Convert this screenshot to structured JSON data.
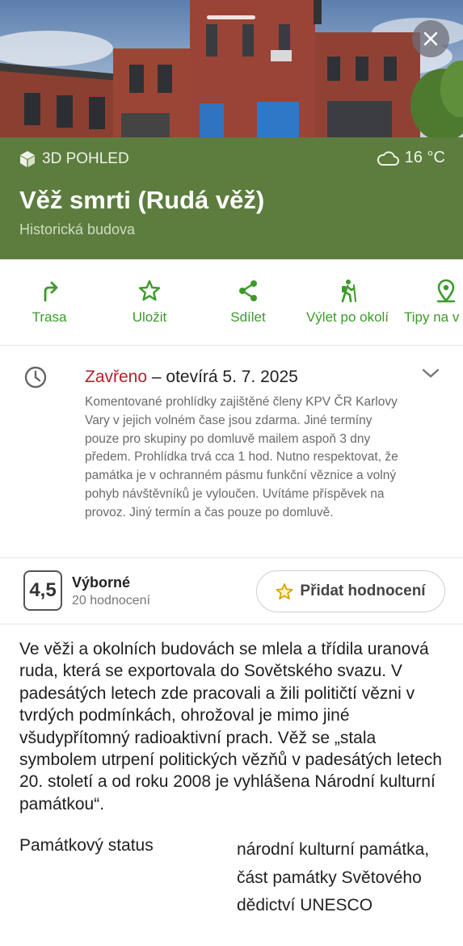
{
  "hero": {
    "image_alt": "Photo of the red brick tower building"
  },
  "header": {
    "view3d_label": "3D POHLED",
    "weather": "16 °C",
    "title": "Věž smrti (Rudá věž)",
    "subtitle": "Historická budova",
    "background_color": "#5d7d3f"
  },
  "actions": [
    {
      "label": "Trasa",
      "icon": "route-icon"
    },
    {
      "label": "Uložit",
      "icon": "star-icon"
    },
    {
      "label": "Sdílet",
      "icon": "share-icon"
    },
    {
      "label": "Výlet po okolí",
      "icon": "hiker-icon"
    },
    {
      "label": "Tipy na v",
      "icon": "location-pin-icon"
    }
  ],
  "accent_color": "#3d9a2b",
  "hours": {
    "status": "Zavřeno",
    "separator": " – otevírá 5. 7. 2025",
    "note": "Komentované prohlídky zajištěné členy KPV ČR Karlovy Vary v jejich volném čase jsou zdarma. Jiné termíny pouze pro skupiny po domluvě mailem aspoň 3 dny předem. Prohlídka trvá cca 1 hod. Nutno respektovat, že památka je v ochranném pásmu funkční věznice a volný pohyb návštěvníků je vyloučen. Uvítáme příspěvek na provoz. Jiný termín a čas pouze po domluvě."
  },
  "rating": {
    "score": "4,5",
    "word": "Výborné",
    "count": "20 hodnocení",
    "add_button": "Přidat hodnocení"
  },
  "description": "Ve věži a okolních budovách se mlela a třídila uranová ruda, která se exportovala do Sovětského svazu. V padesátých letech zde pracovali a žili političtí vězni v tvrdých podmínkách, ohrožoval je mimo jiné všudypřítomný radioaktivní prach. Věž se „stala symbolem utrpení politických vězňů v padesátých letech 20. století a od roku 2008 je vyhlášena Národní kulturní památkou“.",
  "properties": {
    "status_key": "Památkový status",
    "status_value": "národní kulturní památka, část památky Světového dědictví UNESCO"
  }
}
